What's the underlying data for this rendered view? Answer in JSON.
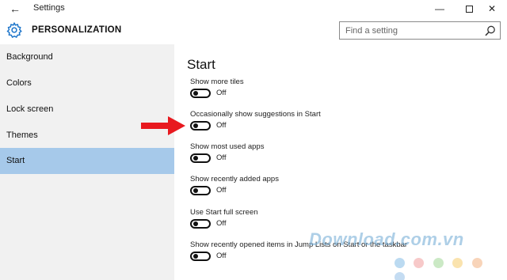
{
  "window": {
    "title": "Settings",
    "back_glyph": "←",
    "minimize_glyph": "—",
    "close_glyph": "✕"
  },
  "header": {
    "section_title": "PERSONALIZATION",
    "icon": "gear-icon",
    "accent_color": "#1a73c9"
  },
  "search": {
    "placeholder": "Find a setting",
    "value": "",
    "icon": "search-icon"
  },
  "sidebar": {
    "items": [
      {
        "label": "Background",
        "active": false
      },
      {
        "label": "Colors",
        "active": false
      },
      {
        "label": "Lock screen",
        "active": false
      },
      {
        "label": "Themes",
        "active": false
      },
      {
        "label": "Start",
        "active": true
      }
    ],
    "active_color": "#a6c9ea",
    "background_color": "#f1f1f1"
  },
  "main": {
    "title": "Start",
    "settings": [
      {
        "label": "Show more tiles",
        "state": "Off",
        "on": false
      },
      {
        "label": "Occasionally show suggestions in Start",
        "state": "Off",
        "on": false
      },
      {
        "label": "Show most used apps",
        "state": "Off",
        "on": false
      },
      {
        "label": "Show recently added apps",
        "state": "Off",
        "on": false
      },
      {
        "label": "Use Start full screen",
        "state": "Off",
        "on": false
      },
      {
        "label": "Show recently opened items in Jump Lists on Start or the taskbar",
        "state": "Off",
        "on": false
      }
    ]
  },
  "annotation": {
    "arrow_color": "#e8191f",
    "points_to": "Occasionally show suggestions in Start"
  },
  "watermark": {
    "text": "Download.com.vn",
    "dot_colors": [
      "#8fc3e8",
      "#f3a6a6",
      "#a9dba0",
      "#f7d27a",
      "#f5b88c",
      "#9ec6ea"
    ]
  }
}
